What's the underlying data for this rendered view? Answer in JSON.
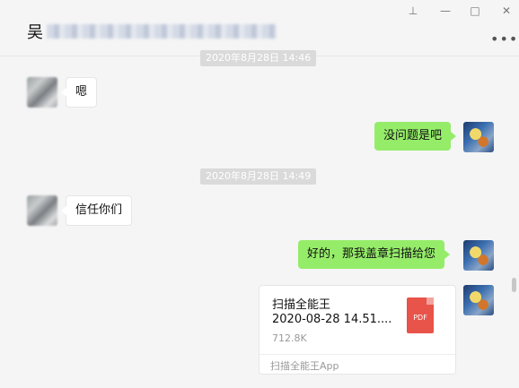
{
  "header": {
    "title": "吴",
    "more_label": "•••"
  },
  "window": {
    "pin": "⊥",
    "minimize": "—",
    "maximize": "□",
    "close": "✕"
  },
  "messages": {
    "ts1": "2020年8月28日 14:46",
    "m1": "嗯",
    "m2": "没问题是吧",
    "ts2": "2020年8月28日 14:49",
    "m3": "信任你们",
    "m4": "好的，那我盖章扫描给您",
    "file": {
      "name": "扫描全能王",
      "subtitle": "2020-08-28 14.51....",
      "size": "712.8K",
      "type_label": "PDF",
      "source": "扫描全能王App"
    }
  },
  "colors": {
    "self_bubble": "#95ec69",
    "other_bubble": "#ffffff",
    "background": "#f5f5f5"
  }
}
